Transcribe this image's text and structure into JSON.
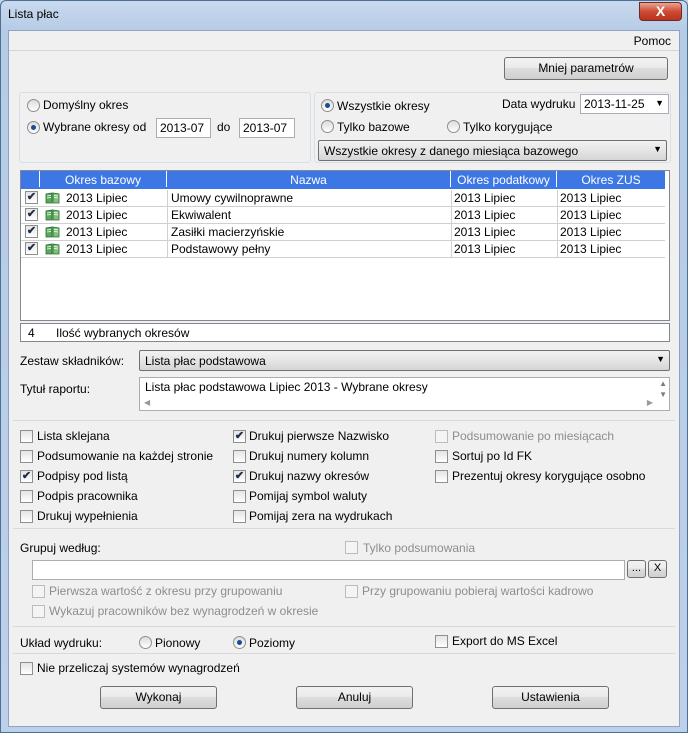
{
  "window": {
    "title": "Lista płac",
    "close_glyph": "X"
  },
  "menu": {
    "help": "Pomoc"
  },
  "buttons": {
    "less_params": "Mniej parametrów",
    "execute": "Wykonaj",
    "cancel": "Anuluj",
    "settings": "Ustawienia",
    "browse": "...",
    "clear": "X"
  },
  "period": {
    "default_label": "Domyślny  okres",
    "selected_label": "Wybrane okresy od",
    "from": "2013-07",
    "to_label": "do",
    "to": "2013-07",
    "selected_option": "selected"
  },
  "filter": {
    "all_label": "Wszystkie okresy",
    "base_only_label": "Tylko bazowe",
    "correcting_only_label": "Tylko korygujące",
    "selected_option": "all",
    "print_date_label": "Data wydruku",
    "print_date": "2013-11-25",
    "scope_select": "Wszystkie okresy z danego miesiąca bazowego"
  },
  "table": {
    "columns": [
      "Okres bazowy",
      "Nazwa",
      "Okres podatkowy",
      "Okres ZUS"
    ],
    "rows": [
      {
        "checked": true,
        "icon": "book-icon",
        "base": "2013 Lipiec",
        "name": "Umowy cywilnoprawne",
        "tax": "2013 Lipiec",
        "zus": "2013 Lipiec"
      },
      {
        "checked": true,
        "icon": "book-icon",
        "base": "2013 Lipiec",
        "name": "Ekwiwalent",
        "tax": "2013 Lipiec",
        "zus": "2013 Lipiec"
      },
      {
        "checked": true,
        "icon": "book-icon",
        "base": "2013 Lipiec",
        "name": "Zasiłki macierzyńskie",
        "tax": "2013 Lipiec",
        "zus": "2013 Lipiec"
      },
      {
        "checked": true,
        "icon": "book-icon",
        "base": "2013 Lipiec",
        "name": "Podstawowy pełny",
        "tax": "2013 Lipiec",
        "zus": "2013 Lipiec"
      }
    ],
    "footer_count": "4",
    "footer_label": "Ilość wybranych okresów"
  },
  "components": {
    "label": "Zestaw składników:",
    "value": "Lista płac podstawowa"
  },
  "report_title": {
    "label": "Tytuł raportu:",
    "value": "Lista płac podstawowa Lipiec 2013 - Wybrane okresy"
  },
  "options": {
    "col1": [
      {
        "label": "Lista sklejana",
        "checked": false,
        "enabled": true
      },
      {
        "label": "Podsumowanie na każdej stronie",
        "checked": false,
        "enabled": true
      },
      {
        "label": "Podpisy pod listą",
        "checked": true,
        "enabled": true
      },
      {
        "label": "Podpis pracownika",
        "checked": false,
        "enabled": true
      },
      {
        "label": "Drukuj wypełnienia",
        "checked": false,
        "enabled": true
      }
    ],
    "col2": [
      {
        "label": "Drukuj pierwsze Nazwisko",
        "checked": true,
        "enabled": true
      },
      {
        "label": "Drukuj numery kolumn",
        "checked": false,
        "enabled": true
      },
      {
        "label": "Drukuj nazwy okresów",
        "checked": true,
        "enabled": true
      },
      {
        "label": "Pomijaj symbol waluty",
        "checked": false,
        "enabled": true
      },
      {
        "label": "Pomijaj zera na wydrukach",
        "checked": false,
        "enabled": true
      }
    ],
    "col3": [
      {
        "label": "Podsumowanie po miesiącach",
        "checked": false,
        "enabled": false
      },
      {
        "label": "Sortuj po Id FK",
        "checked": false,
        "enabled": true
      },
      {
        "label": "Prezentuj okresy korygujące osobno",
        "checked": false,
        "enabled": true
      }
    ]
  },
  "grouping": {
    "label": "Grupuj według:",
    "summary_only": "Tylko podsumowania",
    "value": "",
    "first_value": "Pierwsza wartość z okresu przy grupowaniu",
    "hr_values": "Przy grupowaniu pobieraj wartości kadrowo",
    "show_without_pay": "Wykazuj pracowników bez wynagrodzeń w okresie"
  },
  "layout": {
    "label": "Układ wydruku:",
    "portrait": "Pionowy",
    "landscape": "Poziomy",
    "selected": "landscape",
    "export_excel": "Export do MS Excel",
    "no_recalc": "Nie przeliczaj systemów wynagrodzeń"
  },
  "colors": {
    "header_blue": "#3d77e6",
    "title_bar": "#c4d6ec",
    "close_red": "#cf4a33"
  }
}
